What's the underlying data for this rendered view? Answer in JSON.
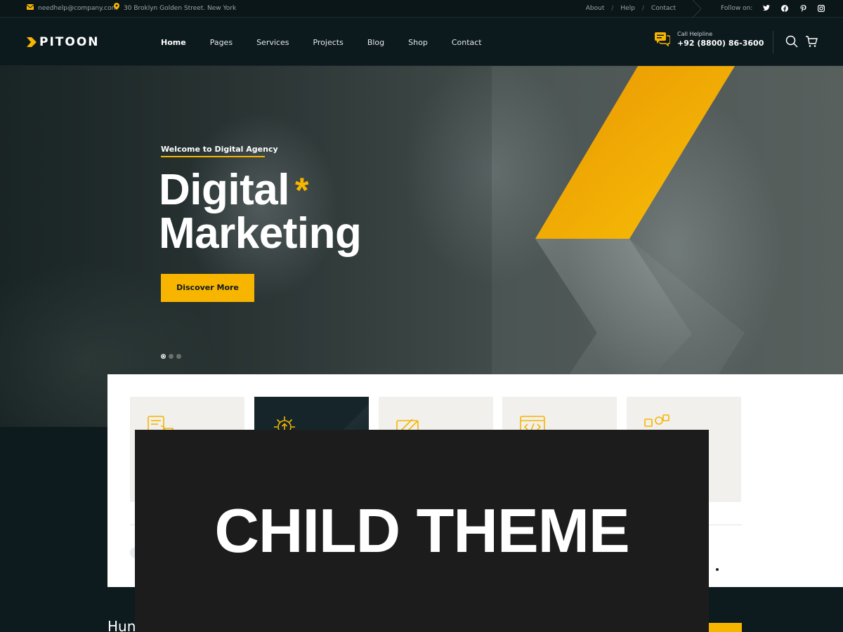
{
  "topbar": {
    "email": "needhelp@company.com",
    "address": "30 Broklyn Golden Street. New York",
    "links": [
      "About",
      "Help",
      "Contact"
    ],
    "follow_label": "Follow on:",
    "social_icons": [
      "twitter-icon",
      "facebook-icon",
      "pinterest-icon",
      "instagram-icon"
    ]
  },
  "header": {
    "logo_text": "PITOON",
    "nav": [
      "Home",
      "Pages",
      "Services",
      "Projects",
      "Blog",
      "Shop",
      "Contact"
    ],
    "active_nav": "Home",
    "helpline_label": "Call Helpline",
    "helpline_number": "+92 (8800) 86-3600"
  },
  "hero": {
    "eyebrow": "Welcome to Digital Agency",
    "title_line1": "Digital",
    "title_star": "*",
    "title_line2": "Marketing",
    "cta_label": "Discover More",
    "slide_count": 3,
    "active_slide": 1
  },
  "services": {
    "cards": [
      {
        "icon": "ecommerce-icon",
        "active": false
      },
      {
        "icon": "gear-upload-icon",
        "active": true
      },
      {
        "icon": "design-tools-icon",
        "active": false
      },
      {
        "icon": "code-browser-icon",
        "active": false
      },
      {
        "icon": "social-media-icon",
        "active": false
      }
    ]
  },
  "lower": {
    "heading_partial": "Hun"
  },
  "overlay": {
    "label": "CHILD THEME"
  },
  "colors": {
    "accent": "#f7b500",
    "dark": "#0d1a1e",
    "overlay": "#1c1c1c"
  }
}
